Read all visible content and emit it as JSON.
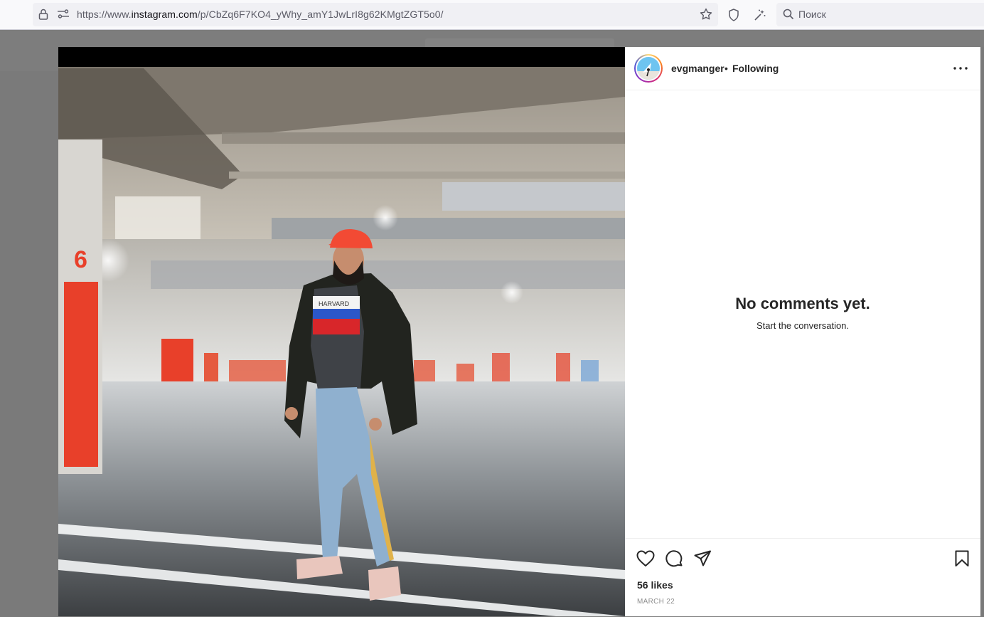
{
  "browser": {
    "url_prefix": "https://www.",
    "url_domain": "instagram.com",
    "url_path": "/p/CbZq6F7KO4_yWhy_amY1JwLrI8g62KMgtZGT5o0/",
    "search_placeholder": "Поиск"
  },
  "post": {
    "username": "evgmanger",
    "separator": "•",
    "follow_status": "Following",
    "no_comments_title": "No comments yet.",
    "no_comments_sub": "Start the conversation.",
    "likes": "56 likes",
    "date": "MARCH 22"
  },
  "photo": {
    "shirt_text_top": "HARVARD",
    "pillar_number": "6"
  },
  "colors": {
    "accent_red": "#e8402a",
    "text_primary": "#262626",
    "text_secondary": "#8e8e8e"
  }
}
